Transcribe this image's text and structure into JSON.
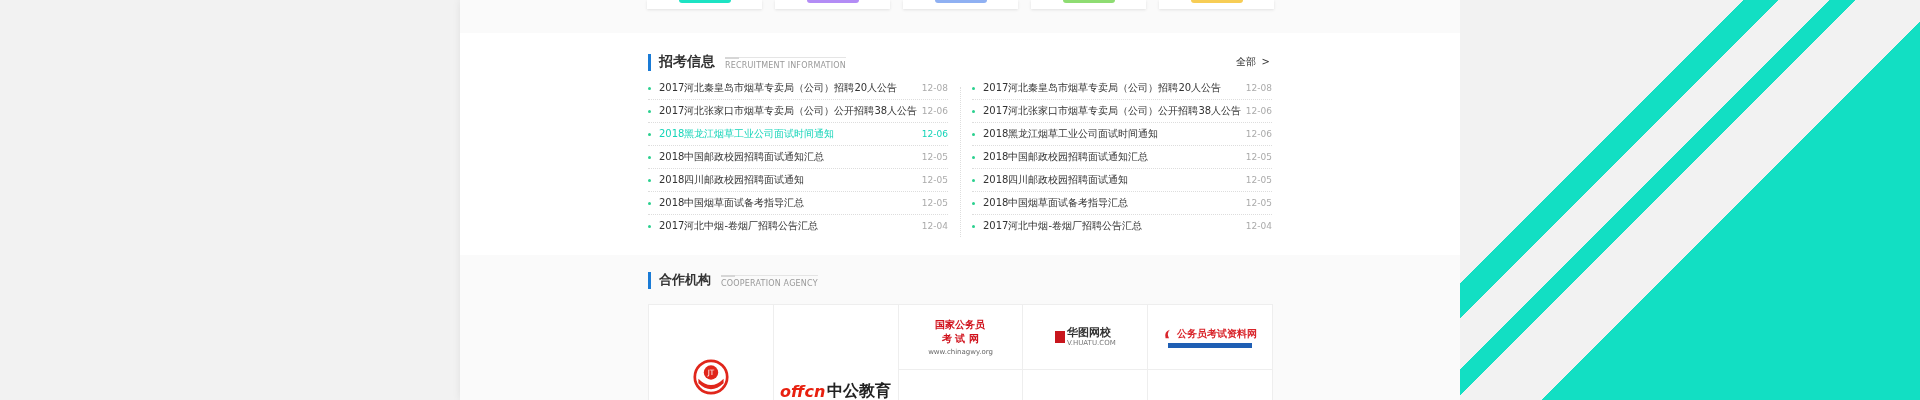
{
  "categories": [
    {
      "color": "#1de3c3"
    },
    {
      "color": "#b38cf5"
    },
    {
      "color": "#8fb0f2"
    },
    {
      "color": "#8edc72"
    },
    {
      "color": "#f7cd55"
    }
  ],
  "recruitment": {
    "title": "招考信息",
    "subtitle": "RECRUITMENT INFORMATION",
    "more": "全部",
    "more_icon": ">",
    "columns": [
      [
        {
          "title": "2017河北秦皇岛市烟草专卖局（公司）招聘20人公告",
          "date": "12-08",
          "selected": false
        },
        {
          "title": "2017河北张家口市烟草专卖局（公司）公开招聘38人公告",
          "date": "12-06",
          "selected": false
        },
        {
          "title": "2018黑龙江烟草工业公司面试时间通知",
          "date": "12-06",
          "selected": true
        },
        {
          "title": "2018中国邮政校园招聘面试通知汇总",
          "date": "12-05",
          "selected": false
        },
        {
          "title": "2018四川邮政校园招聘面试通知",
          "date": "12-05",
          "selected": false
        },
        {
          "title": "2018中国烟草面试备考指导汇总",
          "date": "12-05",
          "selected": false
        },
        {
          "title": "2017河北中烟-卷烟厂招聘公告汇总",
          "date": "12-04",
          "selected": false
        }
      ],
      [
        {
          "title": "2017河北秦皇岛市烟草专卖局（公司）招聘20人公告",
          "date": "12-08",
          "selected": false
        },
        {
          "title": "2017河北张家口市烟草专卖局（公司）公开招聘38人公告",
          "date": "12-06",
          "selected": false
        },
        {
          "title": "2018黑龙江烟草工业公司面试时间通知",
          "date": "12-06",
          "selected": false
        },
        {
          "title": "2018中国邮政校园招聘面试通知汇总",
          "date": "12-05",
          "selected": false
        },
        {
          "title": "2018四川邮政校园招聘面试通知",
          "date": "12-05",
          "selected": false
        },
        {
          "title": "2018中国烟草面试备考指导汇总",
          "date": "12-05",
          "selected": false
        },
        {
          "title": "2017河北中烟-卷烟厂招聘公告汇总",
          "date": "12-04",
          "selected": false
        }
      ]
    ]
  },
  "cooperation": {
    "title": "合作机构",
    "subtitle": "COOPERATION AGENCY",
    "partners": [
      {
        "kind": "jt",
        "mark": "JT"
      },
      {
        "kind": "offcn",
        "latin": "offcn",
        "name": "中公教育"
      },
      {
        "kind": "chinagwy",
        "lines": [
          "国家公务员",
          "考 试 网"
        ],
        "url": "www.chinagwy.org"
      },
      {
        "kind": "huatu",
        "name": "华图网校",
        "url": "V.HUATU.COM"
      },
      {
        "kind": "gwyzl",
        "name": "公务员考试资料网"
      }
    ]
  }
}
